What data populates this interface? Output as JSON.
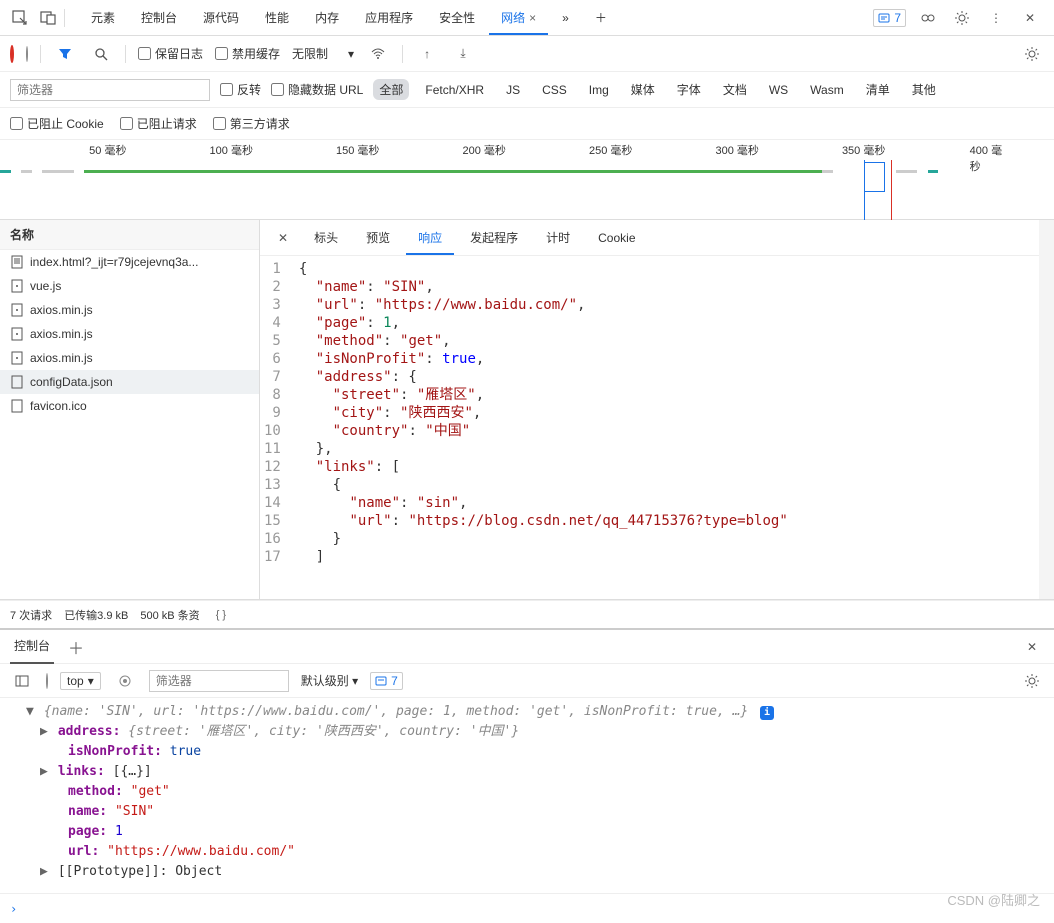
{
  "topbar": {
    "tabs": [
      "元素",
      "控制台",
      "源代码",
      "性能",
      "内存",
      "应用程序",
      "安全性",
      "网络"
    ],
    "active_tab": "网络",
    "issue_count": "7"
  },
  "net_toolbar": {
    "preserve_log": "保留日志",
    "disable_cache": "禁用缓存",
    "throttle": "无限制"
  },
  "filterbar": {
    "placeholder": "筛选器",
    "invert": "反转",
    "hide_data_urls": "隐藏数据 URL",
    "types": [
      "全部",
      "Fetch/XHR",
      "JS",
      "CSS",
      "Img",
      "媒体",
      "字体",
      "文档",
      "WS",
      "Wasm",
      "清单",
      "其他"
    ],
    "active_type": "全部",
    "blocked_cookies": "已阻止 Cookie",
    "blocked_requests": "已阻止请求",
    "third_party": "第三方请求"
  },
  "timeline": {
    "ticks": [
      "50 毫秒",
      "100 毫秒",
      "150 毫秒",
      "200 毫秒",
      "250 毫秒",
      "300 毫秒",
      "350 毫秒",
      "400 毫秒"
    ]
  },
  "requests": {
    "header": "名称",
    "items": [
      {
        "name": "index.html?_ijt=r79jcejevnq3a...",
        "icon": "doc"
      },
      {
        "name": "vue.js",
        "icon": "js"
      },
      {
        "name": "axios.min.js",
        "icon": "js"
      },
      {
        "name": "axios.min.js",
        "icon": "js"
      },
      {
        "name": "axios.min.js",
        "icon": "js"
      },
      {
        "name": "configData.json",
        "icon": "json",
        "selected": true
      },
      {
        "name": "favicon.ico",
        "icon": "ico"
      }
    ]
  },
  "detail": {
    "tabs": [
      "标头",
      "预览",
      "响应",
      "发起程序",
      "计时",
      "Cookie"
    ],
    "active": "响应",
    "code_lines": [
      {
        "n": 1,
        "t": "{"
      },
      {
        "n": 2,
        "t": "  \"name\": \"SIN\","
      },
      {
        "n": 3,
        "t": "  \"url\": \"https://www.baidu.com/\","
      },
      {
        "n": 4,
        "t": "  \"page\": 1,"
      },
      {
        "n": 5,
        "t": "  \"method\": \"get\","
      },
      {
        "n": 6,
        "t": "  \"isNonProfit\": true,"
      },
      {
        "n": 7,
        "t": "  \"address\": {"
      },
      {
        "n": 8,
        "t": "    \"street\": \"雁塔区\","
      },
      {
        "n": 9,
        "t": "    \"city\": \"陕西西安\","
      },
      {
        "n": 10,
        "t": "    \"country\": \"中国\""
      },
      {
        "n": 11,
        "t": "  },"
      },
      {
        "n": 12,
        "t": "  \"links\": ["
      },
      {
        "n": 13,
        "t": "    {"
      },
      {
        "n": 14,
        "t": "      \"name\": \"sin\","
      },
      {
        "n": 15,
        "t": "      \"url\": \"https://blog.csdn.net/qq_44715376?type=blog\""
      },
      {
        "n": 16,
        "t": "    }"
      },
      {
        "n": 17,
        "t": "  ]"
      }
    ]
  },
  "status": {
    "requests": "7 次请求",
    "transferred": "已传输3.9 kB",
    "resources": "500 kB 条资"
  },
  "console": {
    "tab": "控制台",
    "context": "top",
    "filter_placeholder": "筛选器",
    "level": "默认级别",
    "issue_count": "7",
    "preview": "{name: 'SIN', url: 'https://www.baidu.com/', page: 1, method: 'get', isNonProfit: true, …}",
    "address_preview": "{street: '雁塔区', city: '陕西西安', country: '中国'}",
    "props": {
      "address": "address:",
      "isNonProfit_k": "isNonProfit:",
      "isNonProfit_v": "true",
      "links_k": "links:",
      "links_v": "[{…}]",
      "method_k": "method:",
      "method_v": "\"get\"",
      "name_k": "name:",
      "name_v": "\"SIN\"",
      "page_k": "page:",
      "page_v": "1",
      "url_k": "url:",
      "url_v": "\"https://www.baidu.com/\"",
      "proto_k": "[[Prototype]]:",
      "proto_v": "Object"
    }
  },
  "watermark": "CSDN @陆卿之"
}
